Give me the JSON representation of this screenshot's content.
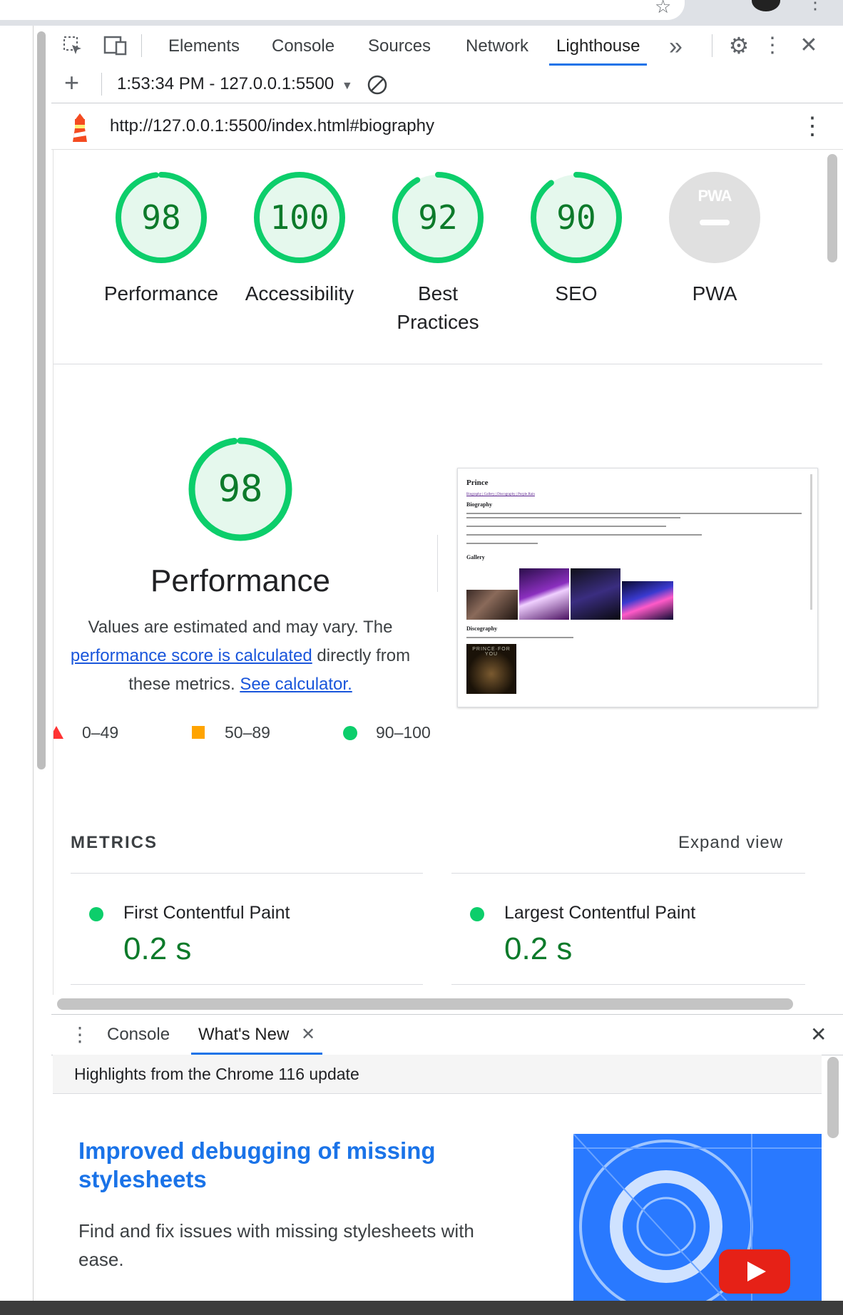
{
  "devtools": {
    "tabs": [
      {
        "label": "Elements"
      },
      {
        "label": "Console"
      },
      {
        "label": "Sources"
      },
      {
        "label": "Network"
      },
      {
        "label": "Lighthouse",
        "active": true
      }
    ],
    "more_tabs": "»",
    "report_selector": "1:53:34 PM - 127.0.0.1:5500",
    "url": "http://127.0.0.1:5500/index.html#biography"
  },
  "scores": [
    {
      "label": "Performance",
      "score": "98",
      "value": 98
    },
    {
      "label": "Accessibility",
      "score": "100",
      "value": 100
    },
    {
      "label": "Best Practices",
      "score": "92",
      "value": 92
    },
    {
      "label": "SEO",
      "score": "90",
      "value": 90
    },
    {
      "label": "PWA",
      "score": "",
      "value": null,
      "badge": "PWA"
    }
  ],
  "performance": {
    "score": "98",
    "value": 98,
    "title": "Performance",
    "desc_1": "Values are estimated and may vary. The",
    "desc_link_1": "performance score is calculated",
    "desc_2": "directly from",
    "desc_3": "these metrics.",
    "desc_link_2": "See calculator.",
    "legend": [
      {
        "range": "0–49",
        "color": "#ff3333"
      },
      {
        "range": "50–89",
        "color": "#ffa400"
      },
      {
        "range": "90–100",
        "color": "#0cce6b"
      }
    ]
  },
  "thumbnail": {
    "site_title": "Prince",
    "nav": "Biography | Gallery | Discography | Purple Rain",
    "h_bio": "Biography",
    "h_gallery": "Gallery",
    "h_disco": "Discography",
    "album_text": "PRINCE·FOR YOU"
  },
  "metrics": {
    "title": "METRICS",
    "expand": "Expand view",
    "items": [
      {
        "name": "First Contentful Paint",
        "value": "0.2 s"
      },
      {
        "name": "Largest Contentful Paint",
        "value": "0.2 s"
      }
    ]
  },
  "drawer": {
    "tabs": [
      {
        "label": "Console"
      },
      {
        "label": "What's New",
        "active": true
      }
    ],
    "header": "Highlights from the Chrome 116 update",
    "article_title": "Improved debugging of missing stylesheets",
    "article_desc": "Find and fix issues with missing stylesheets with ease."
  },
  "colors": {
    "accent": "#1a73e8",
    "pass": "#0cce6b",
    "pass_text": "#0c7a2a",
    "link": "#1a56db"
  }
}
